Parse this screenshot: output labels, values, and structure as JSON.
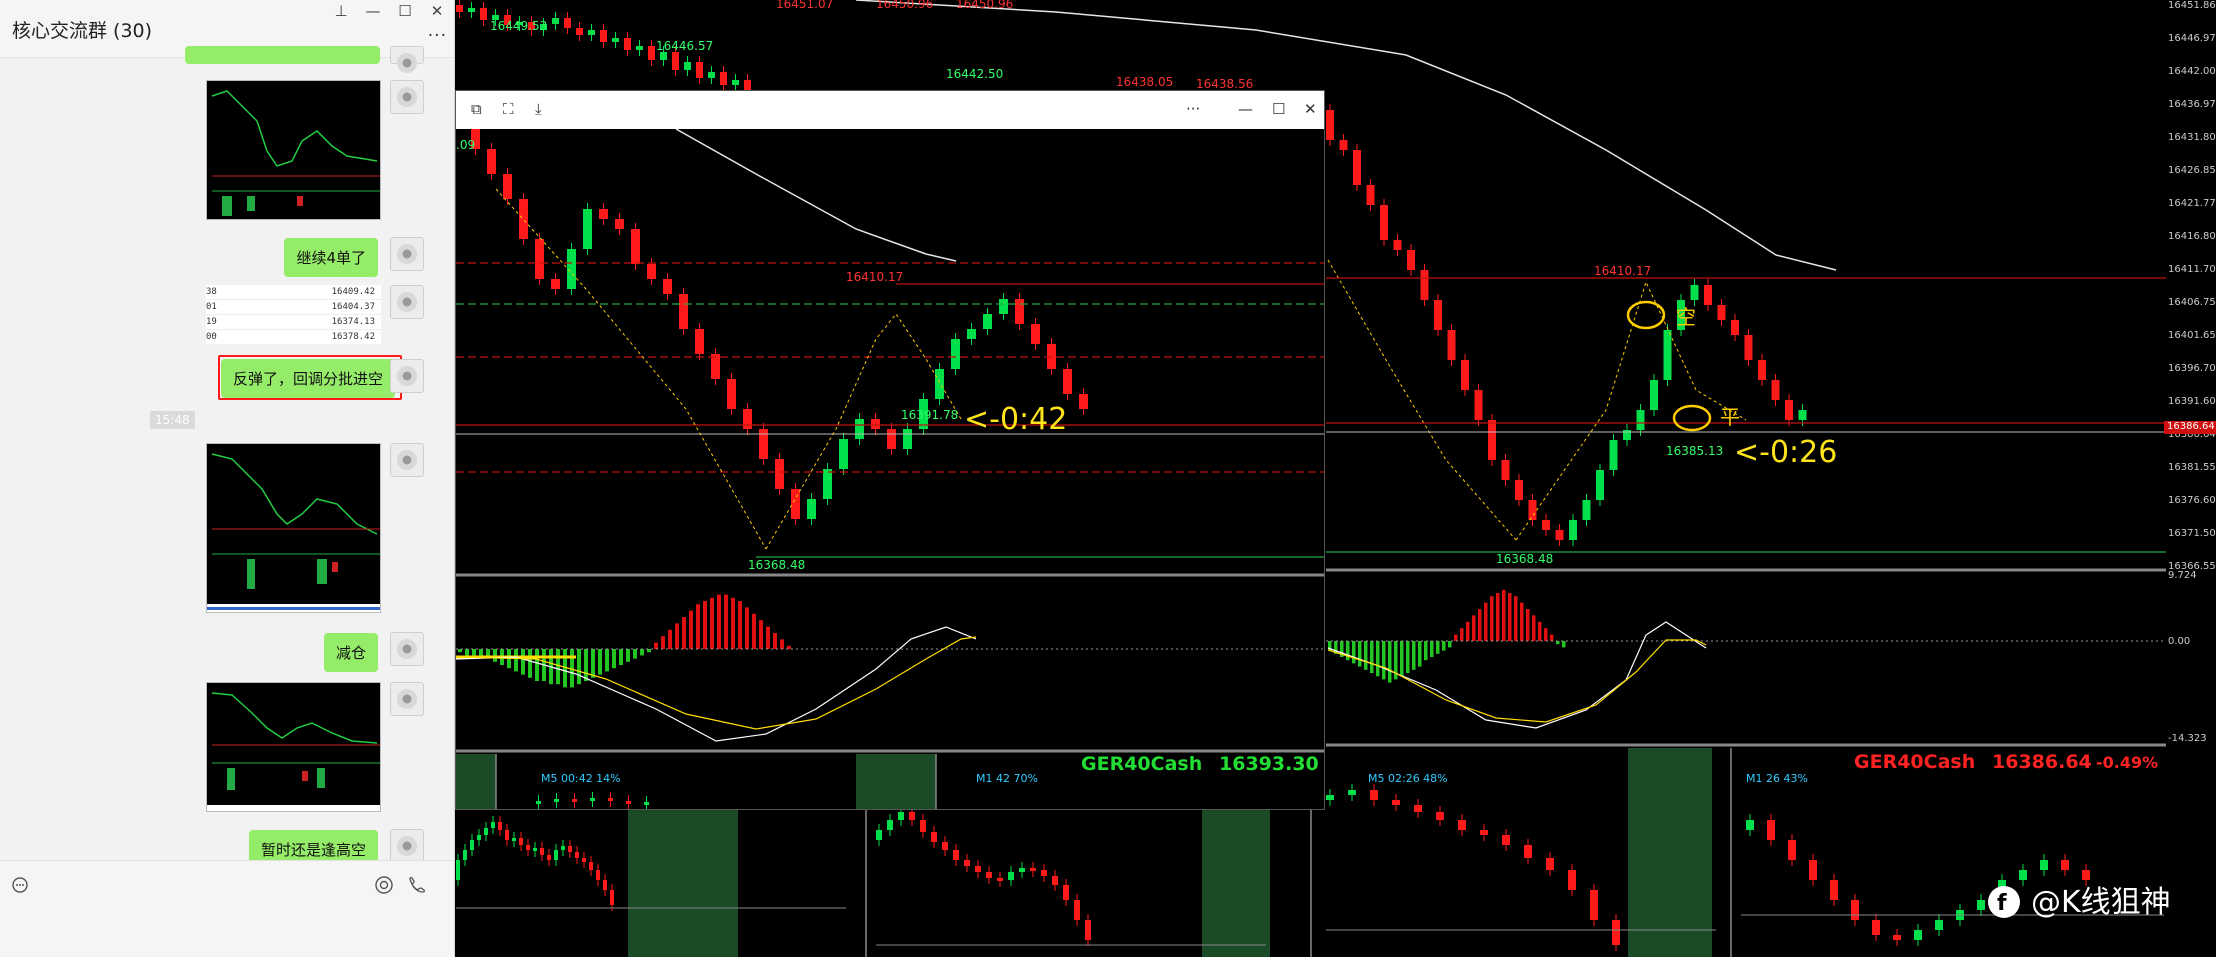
{
  "chat": {
    "title": "核心交流群 (30)",
    "window_controls": [
      "📌",
      "—",
      "☐",
      "✕"
    ],
    "more_label": "···",
    "messages": [
      {
        "type": "image"
      },
      {
        "type": "text",
        "text": "继续4单了"
      },
      {
        "type": "pricecard",
        "rows": [
          {
            "left": "38",
            "value": "16409.42"
          },
          {
            "left": "01",
            "value": "16404.37"
          },
          {
            "left": "19",
            "value": "16374.13"
          },
          {
            "left": "00",
            "value": "16378.42"
          }
        ]
      },
      {
        "type": "text",
        "text": "反弹了，回调分批进空",
        "highlight": true
      },
      {
        "type": "time",
        "text": "15:48"
      },
      {
        "type": "image"
      },
      {
        "type": "text",
        "text": "减仓"
      },
      {
        "type": "image"
      },
      {
        "type": "text",
        "text": "暂时还是逢高空"
      }
    ],
    "footer_icons": [
      "chat-bubble-icon",
      "camera-icon",
      "phone-icon"
    ]
  },
  "right_axis": {
    "ticks": [
      "16451.86",
      "16446.97",
      "16442.00",
      "16436.97",
      "16431.80",
      "16426.85",
      "16421.77",
      "16416.80",
      "16411.70",
      "16406.75",
      "16401.65",
      "16396.70",
      "16391.60",
      "16386.64",
      "16381.55",
      "16376.60",
      "16371.50",
      "16366.55"
    ],
    "current_price": "16386.64",
    "indicator_ticks": [
      "9.724",
      "0.00",
      "-14.323"
    ]
  },
  "bg_chart": {
    "top_labels": [
      {
        "text": "16449.53",
        "color": "#33ff66"
      },
      {
        "text": "16446.57",
        "color": "#33ff66"
      },
      {
        "text": "16451.07",
        "color": "#ff3333"
      },
      {
        "text": "16450.96",
        "color": "#ff3333"
      },
      {
        "text": "16450.96",
        "color": "#ff3333"
      },
      {
        "text": "16442.50",
        "color": "#33ff66"
      },
      {
        "text": "16438.05",
        "color": "#ff3333"
      },
      {
        "text": "16438.56",
        "color": "#ff3333"
      }
    ],
    "high_label": "16410.17",
    "low_label": "16368.48",
    "last_label": "16385.13",
    "short_mark": "空",
    "close_mark": "平",
    "timer": "<-0:26",
    "symbol": "GER40Cash",
    "price": "16386.64",
    "change": "-0.49%",
    "sub_panels": [
      {
        "label": "M5  02:26  48%"
      },
      {
        "label": "M1  26  43%"
      }
    ],
    "watermark": "@K线狙神"
  },
  "popup": {
    "left_label": ".09",
    "high_label": "16410.17",
    "low_label": "16368.48",
    "last_label": "16391.78",
    "timer": "<-0:42",
    "symbol": "GER40Cash",
    "price": "16393.30",
    "sub_panels": [
      {
        "label": "M5  00:42  14%"
      },
      {
        "label": "M1  42  70%"
      }
    ]
  },
  "colors": {
    "bull": "#00e04a",
    "bear": "#ff1a1a",
    "macd_up": "#e01010",
    "macd_down": "#22c522",
    "symbol_green": "#22dd33",
    "symbol_red": "#ff2222",
    "timer": "#ffe41c",
    "chat_bubble": "#95ec69"
  }
}
